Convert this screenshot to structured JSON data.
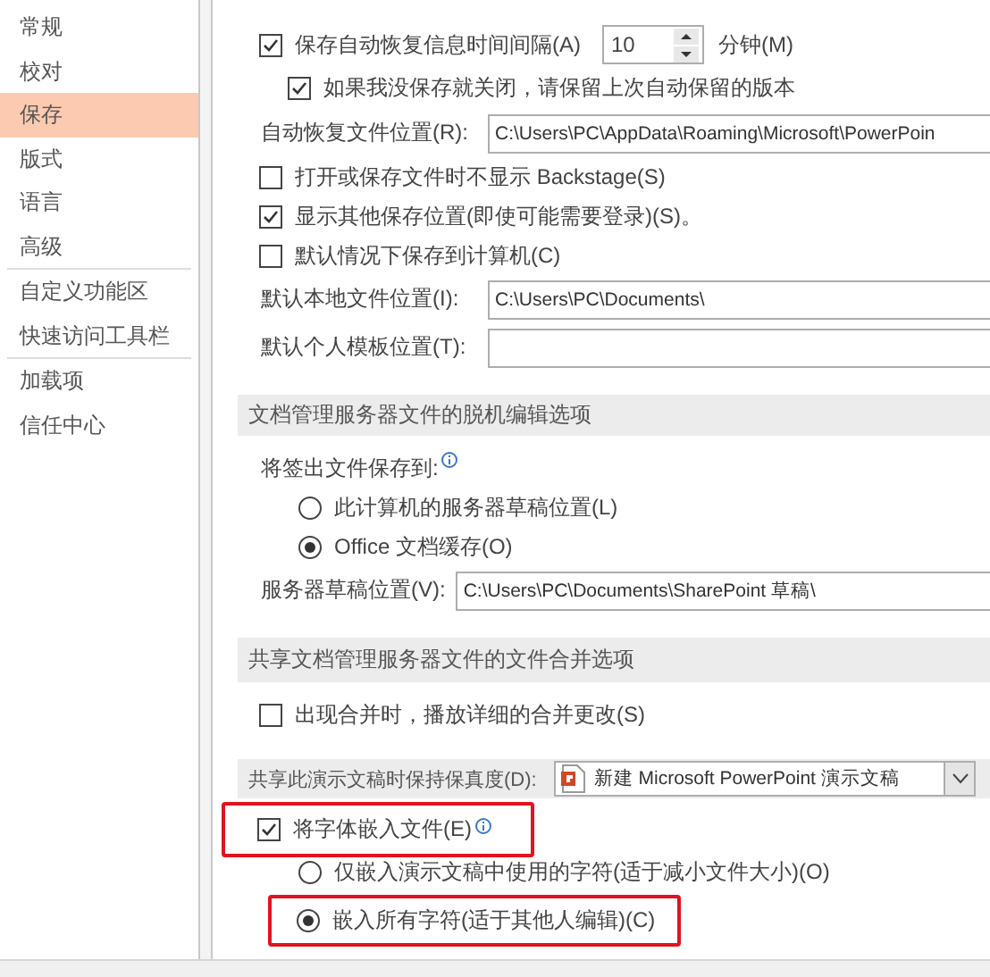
{
  "sidebar": {
    "groups": [
      {
        "items": [
          {
            "label": "常规",
            "selected": false
          },
          {
            "label": "校对",
            "selected": false
          },
          {
            "label": "保存",
            "selected": true
          },
          {
            "label": "版式",
            "selected": false
          },
          {
            "label": "语言",
            "selected": false
          },
          {
            "label": "高级",
            "selected": false
          }
        ]
      },
      {
        "items": [
          {
            "label": "自定义功能区",
            "selected": false
          },
          {
            "label": "快速访问工具栏",
            "selected": false
          }
        ]
      },
      {
        "items": [
          {
            "label": "加载项",
            "selected": false
          },
          {
            "label": "信任中心",
            "selected": false
          }
        ]
      }
    ]
  },
  "sections": [
    {
      "rows": [
        {
          "kind": "spinner",
          "label": "保存自动恢复信息时间间隔(A)",
          "checked": true,
          "value": "10",
          "unit": "分钟(M)",
          "children": [
            {
              "kind": "checkbox",
              "label": "如果我没保存就关闭，请保留上次自动保留的版本",
              "checked": true
            }
          ]
        },
        {
          "kind": "field",
          "label": "自动恢复文件位置(R):",
          "value": "C:\\Users\\PC\\AppData\\Roaming\\Microsoft\\PowerPoin"
        },
        {
          "kind": "checkbox",
          "label": "打开或保存文件时不显示 Backstage(S)",
          "checked": false
        },
        {
          "kind": "checkbox",
          "label": "显示其他保存位置(即使可能需要登录)(S)。",
          "checked": true
        },
        {
          "kind": "checkbox",
          "label": "默认情况下保存到计算机(C)",
          "checked": false
        },
        {
          "kind": "field",
          "label": "默认本地文件位置(I):",
          "value": "C:\\Users\\PC\\Documents\\"
        },
        {
          "kind": "field",
          "label": "默认个人模板位置(T):"
        }
      ]
    },
    {
      "header": "文档管理服务器文件的脱机编辑选项",
      "rows": [
        {
          "kind": "label",
          "label": "将签出文件保存到:",
          "info": true,
          "children": [
            {
              "kind": "radio",
              "label": "此计算机的服务器草稿位置(L)",
              "selected": false
            },
            {
              "kind": "radio",
              "label": "Office 文档缓存(O)",
              "selected": true
            }
          ]
        },
        {
          "kind": "field",
          "label": "服务器草稿位置(V):",
          "value": "C:\\Users\\PC\\Documents\\SharePoint 草稿\\"
        }
      ]
    },
    {
      "header": "共享文档管理服务器文件的文件合并选项",
      "rows": [
        {
          "kind": "checkbox",
          "label": "出现合并时，播放详细的合并更改(S)",
          "checked": false
        },
        {
          "kind": "dropdown",
          "label": "共享此演示文稿时保持保真度(D):",
          "value": "新建 Microsoft PowerPoint 演示文稿"
        },
        {
          "kind": "checkbox",
          "label": "将字体嵌入文件(E)",
          "checked": true,
          "info": true,
          "highlighted": true,
          "children": [
            {
              "kind": "radio",
              "label": "仅嵌入演示文稿中使用的字符(适于减小文件大小)(O)",
              "selected": false,
              "highlighted": false
            },
            {
              "kind": "radio",
              "label": "嵌入所有字符(适于其他人编辑)(C)",
              "selected": true,
              "highlighted": true
            }
          ]
        }
      ]
    }
  ]
}
